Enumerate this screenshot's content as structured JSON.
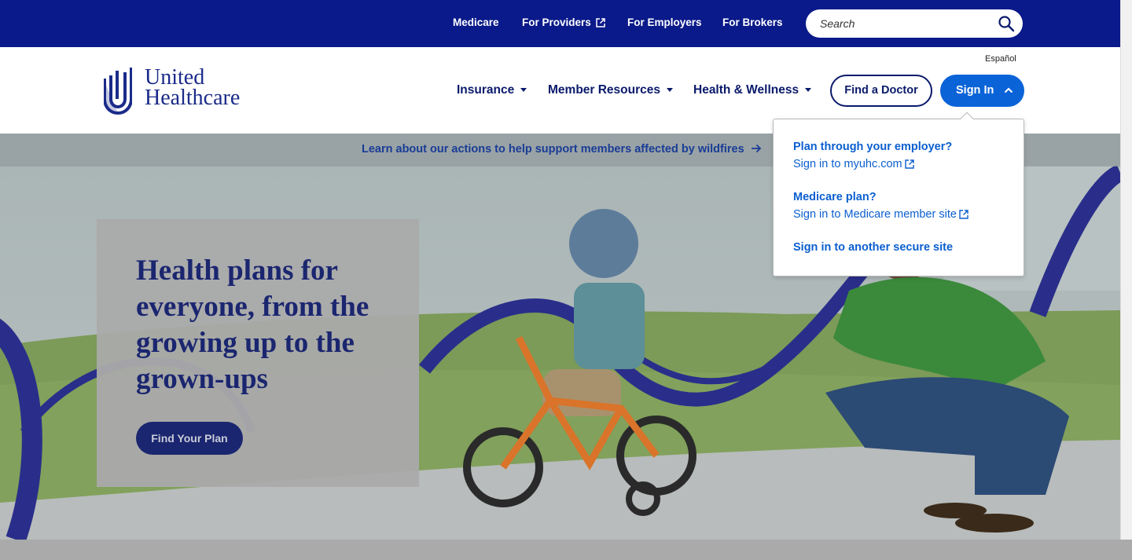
{
  "utility_nav": {
    "links": [
      {
        "label": "Medicare",
        "external": false
      },
      {
        "label": "For Providers",
        "external": true
      },
      {
        "label": "For Employers",
        "external": false
      },
      {
        "label": "For Brokers",
        "external": false
      }
    ],
    "search": {
      "placeholder": "Search",
      "value": "",
      "icon": "search-icon"
    }
  },
  "header": {
    "logo_line1": "United",
    "logo_line2": "Healthcare",
    "language_link": "Español",
    "nav": [
      {
        "label": "Insurance"
      },
      {
        "label": "Member Resources"
      },
      {
        "label": "Health & Wellness"
      }
    ],
    "find_doctor_label": "Find a Doctor",
    "sign_in_label": "Sign In"
  },
  "alert": {
    "text": "Learn about our actions to help support members affected by wildfires",
    "icon": "arrow-right-icon"
  },
  "hero": {
    "title": "Health plans for everyone, from the growing up to the grown-ups",
    "cta_label": "Find Your Plan"
  },
  "sign_in_menu": {
    "sections": [
      {
        "heading": "Plan through your employer?",
        "link": "Sign in to myuhc.com",
        "external": true
      },
      {
        "heading": "Medicare plan?",
        "link": "Sign in to Medicare member site",
        "external": true
      }
    ],
    "other_link": "Sign in to another secure site"
  },
  "colors": {
    "top_bar": "#0a1a8a",
    "brand_navy": "#1b2670",
    "primary_blue": "#0b63d8",
    "link_blue": "#0b5fcf"
  }
}
